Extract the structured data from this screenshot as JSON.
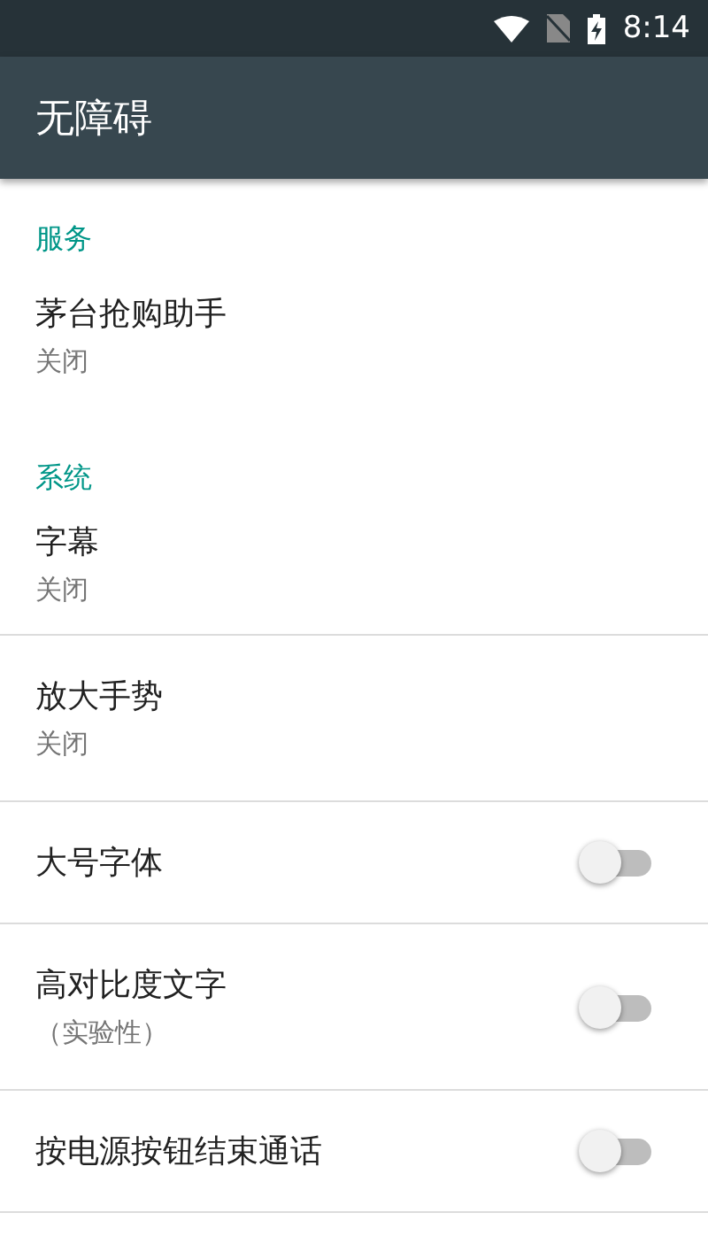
{
  "status_bar": {
    "time": "8:14"
  },
  "app_bar": {
    "title": "无障碍"
  },
  "sections": [
    {
      "title": "服务",
      "items": [
        {
          "kind": "text",
          "title": "茅台抢购助手",
          "summary": "关闭"
        }
      ]
    },
    {
      "title": "系统",
      "items": [
        {
          "kind": "text",
          "title": "字幕",
          "summary": "关闭"
        },
        {
          "kind": "text",
          "title": "放大手势",
          "summary": "关闭"
        },
        {
          "kind": "switch",
          "title": "大号字体",
          "on": false
        },
        {
          "kind": "switch",
          "title": "高对比度文字",
          "summary": "（实验性）",
          "on": false
        },
        {
          "kind": "switch",
          "title": "按电源按钮结束通话",
          "on": false
        }
      ]
    }
  ]
}
